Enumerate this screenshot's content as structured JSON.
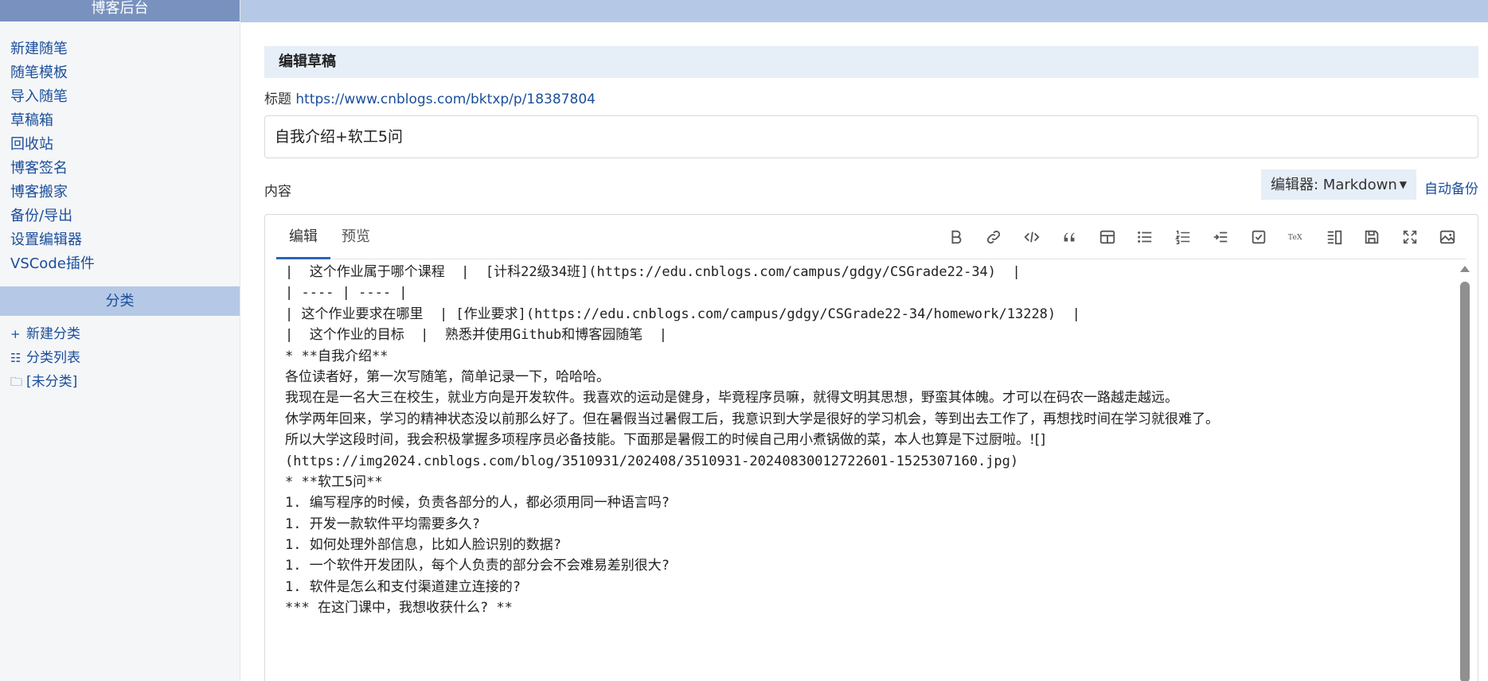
{
  "sidebar": {
    "header": "博客后台",
    "nav": [
      {
        "label": "新建随笔"
      },
      {
        "label": "随笔模板"
      },
      {
        "label": "导入随笔"
      },
      {
        "label": "草稿箱"
      },
      {
        "label": "回收站"
      },
      {
        "label": "博客签名"
      },
      {
        "label": "博客搬家"
      },
      {
        "label": "备份/导出"
      },
      {
        "label": "设置编辑器"
      },
      {
        "label": "VSCode插件"
      }
    ],
    "category_header": "分类",
    "categories": [
      {
        "icon": "plus-icon",
        "glyph": "+",
        "label": "新建分类"
      },
      {
        "icon": "list-icon",
        "glyph": "☷",
        "label": "分类列表"
      },
      {
        "icon": "folder-icon",
        "glyph": "🗀",
        "label": "[未分类]"
      }
    ]
  },
  "main": {
    "panel_title": "编辑草稿",
    "title_label": "标题",
    "title_link": "https://www.cnblogs.com/bktxp/p/18387804",
    "title_value": "自我介绍+软工5问",
    "content_label": "内容",
    "editor_select": "编辑器: Markdown",
    "autobackup": "自动备份",
    "tabs": [
      {
        "label": "编辑",
        "active": true
      },
      {
        "label": "预览",
        "active": false
      }
    ],
    "toolbar_icons": [
      "bold-icon",
      "link-icon",
      "code-icon",
      "quote-icon",
      "table-icon",
      "bullet-list-icon",
      "numbered-list-icon",
      "indent-icon",
      "checkbox-icon",
      "tex-icon",
      "split-view-icon",
      "save-icon",
      "fullscreen-icon",
      "image-icon"
    ],
    "content_lines": [
      "|  这个作业属于哪个课程  |  [计科22级34班](https://edu.cnblogs.com/campus/gdgy/CSGrade22-34)  |",
      "| ---- | ---- |",
      "| 这个作业要求在哪里  | [作业要求](https://edu.cnblogs.com/campus/gdgy/CSGrade22-34/homework/13228)  |",
      "|  这个作业的目标  |  熟悉并使用Github和博客园随笔  |",
      "* **自我介绍**",
      "各位读者好，第一次写随笔，简单记录一下，哈哈哈。",
      "我现在是一名大三在校生，就业方向是开发软件。我喜欢的运动是健身，毕竟程序员嘛，就得文明其思想，野蛮其体魄。才可以在码农一路越走越远。",
      "休学两年回来，学习的精神状态没以前那么好了。但在暑假当过暑假工后，我意识到大学是很好的学习机会，等到出去工作了，再想找时间在学习就很难了。",
      "所以大学这段时间，我会积极掌握多项程序员必备技能。下面那是暑假工的时候自己用小煮锅做的菜，本人也算是下过厨啦。![]",
      "(https://img2024.cnblogs.com/blog/3510931/202408/3510931-20240830012722601-1525307160.jpg)",
      "* **软工5问**",
      "1. 编写程序的时候，负责各部分的人，都必须用同一种语言吗?",
      "1. 开发一款软件平均需要多久?",
      "1. 如何处理外部信息，比如人脸识别的数据?",
      "1. 一个软件开发团队，每个人负责的部分会不会难易差别很大?",
      "1. 软件是怎么和支付渠道建立连接的?",
      "*** 在这门课中，我想收获什么? **"
    ]
  }
}
